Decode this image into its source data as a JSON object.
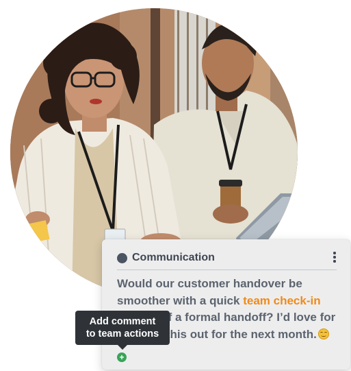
{
  "card": {
    "category": "Communication",
    "category_color": "#4a5462",
    "message_before": "Would our customer handover be smoother with a quick ",
    "message_highlight": "team check-in",
    "message_after": " instead of a formal handoff? I’d love for us to try this out for the next month.",
    "highlight_color": "#f08a18",
    "emoji_icon": "smiling-face-emoji"
  },
  "tooltip": {
    "line1": "Add comment",
    "line2": "to team actions"
  },
  "add_button": {
    "icon": "plus-icon",
    "symbol": "+",
    "color": "#3aa458"
  },
  "menu_icon": "vertical-ellipsis-icon"
}
